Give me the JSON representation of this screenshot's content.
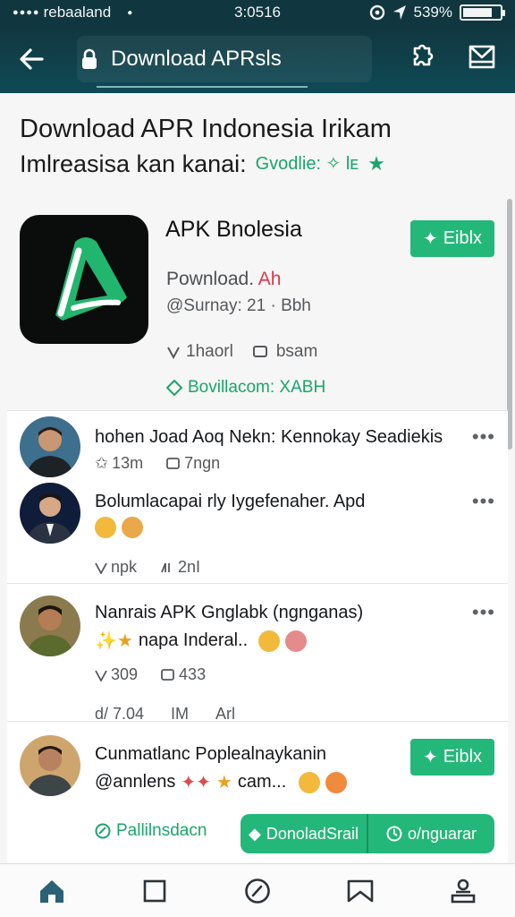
{
  "status_bar": {
    "carrier": "rebaaland",
    "time": "3:0516",
    "battery": "539%",
    "battery_level": 0.8
  },
  "app_bar": {
    "title": "Download APRsls",
    "icons": [
      "back-arrow-icon",
      "lock-icon",
      "puzzle-icon",
      "inbox-icon"
    ]
  },
  "headline": {
    "line1": "Download APR Indonesia Irikam",
    "line2": "Imlreasisa kan kanai:",
    "tagline": "Gvodlie: ✧ lᴇ",
    "star": "★"
  },
  "app_card": {
    "name": "APK Bnolesia",
    "subtitle_prefix": "Pownload.",
    "subtitle_accent": "Ah",
    "size_line": "@Surnay: 21 · Bbh",
    "stat1": "1haorl",
    "stat2": "bsam",
    "download_label": "Bovillacom: XABH",
    "install_label": "Eiblx"
  },
  "feed": [
    {
      "title": "hohen Joad Aoq Nekn: Kennokay Seadiekis",
      "meta1": "13m",
      "meta1_prefix": "✩",
      "meta2": "7ngn"
    },
    {
      "title": "Bolumlacapai rly Iygefenaher. Apd",
      "meta1": "npk",
      "meta2": "2nI"
    },
    {
      "title": "Nanrais APK Gnglabk (ngnganas)",
      "text": "napa Inderal..",
      "meta1": "309",
      "meta2": "433",
      "meta3": "d/ 7.04",
      "meta4": "IM",
      "meta5": "Arl"
    },
    {
      "title": "Cunmatlanc Poplealnaykanin",
      "text": "@annlens",
      "text2": "cam...",
      "install_label": "Eiblx"
    }
  ],
  "bottom_actions": {
    "link": "Pallilnsdacn",
    "btn_left": "DonoladSrail",
    "btn_right": "o/nguarar"
  },
  "colors": {
    "accent_green": "#24b77a",
    "header_teal": "#10363f",
    "alert_red": "#e0364b"
  },
  "bottom_nav": [
    "home-icon",
    "square-icon",
    "compass-icon",
    "bookmark-icon",
    "profile-icon"
  ]
}
